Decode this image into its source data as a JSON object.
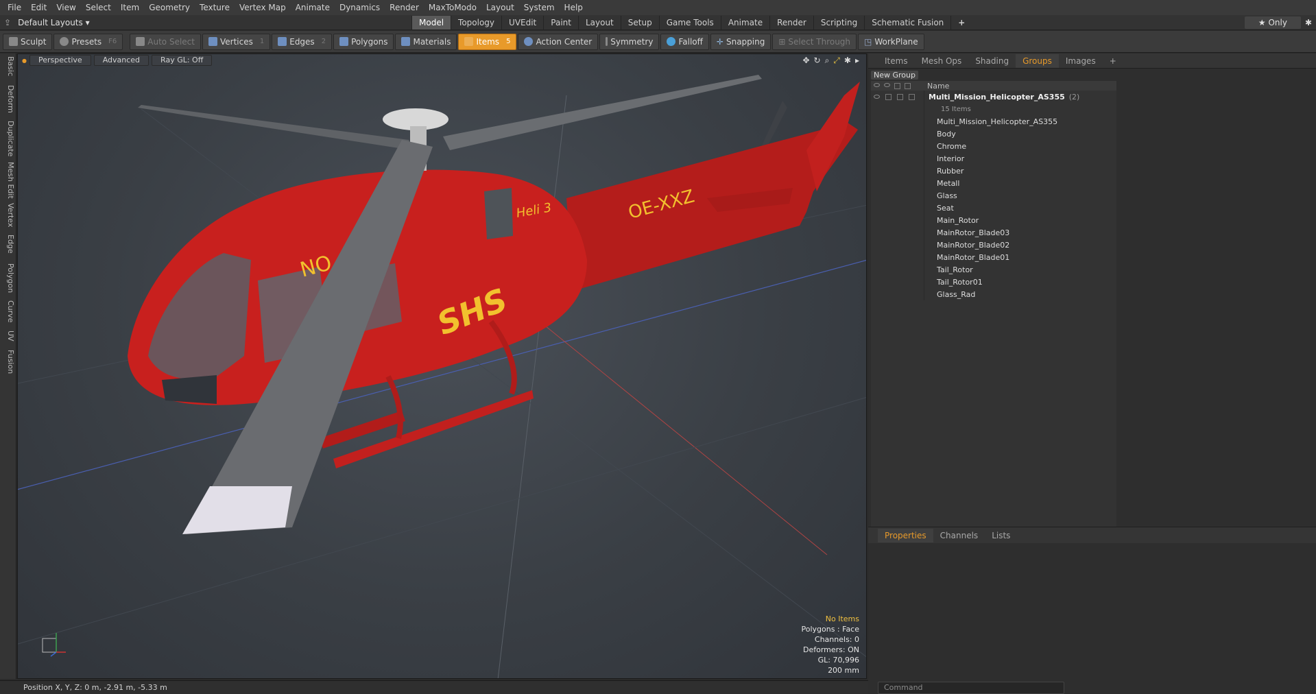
{
  "menu": [
    "File",
    "Edit",
    "View",
    "Select",
    "Item",
    "Geometry",
    "Texture",
    "Vertex Map",
    "Animate",
    "Dynamics",
    "Render",
    "MaxToModo",
    "Layout",
    "System",
    "Help"
  ],
  "layout": {
    "preset": "Default Layouts ▾",
    "tabs": [
      "Model",
      "Topology",
      "UVEdit",
      "Paint",
      "Layout",
      "Setup",
      "Game Tools",
      "Animate",
      "Render",
      "Scripting",
      "Schematic Fusion"
    ],
    "active_tab": "Model",
    "add": "+",
    "only": "★ Only"
  },
  "toolbar": {
    "sculpt": "Sculpt",
    "presets": "Presets",
    "presets_key": "F6",
    "auto_select": "Auto Select",
    "vertices": "Vertices",
    "vertices_key": "1",
    "edges": "Edges",
    "edges_key": "2",
    "polygons": "Polygons",
    "materials": "Materials",
    "items": "Items",
    "items_key": "5",
    "action_center": "Action Center",
    "symmetry": "Symmetry",
    "falloff": "Falloff",
    "snapping": "Snapping",
    "select_through": "Select Through",
    "workplane": "WorkPlane"
  },
  "left_tabs": [
    "Basic",
    "Deform",
    "Duplicate",
    "Mesh Edit",
    "Vertex",
    "Edge",
    "Polygon",
    "Curve",
    "UV",
    "Fusion"
  ],
  "viewport": {
    "view": "Perspective",
    "shading": "Advanced",
    "raygl": "Ray GL: Off",
    "hud": {
      "items": "No Items",
      "polygons": "Polygons : Face",
      "channels": "Channels: 0",
      "deformers": "Deformers: ON",
      "gl": "GL: 70,996",
      "unit": "200 mm"
    },
    "decals": {
      "reg": "OE-XXZ",
      "heli": "Heli 3",
      "shs": "SHS",
      "no": "NO"
    }
  },
  "panel": {
    "tabs": [
      "Items",
      "Mesh Ops",
      "Shading",
      "Groups",
      "Images"
    ],
    "active_tab": "Groups",
    "add": "+",
    "new_group": "New Group",
    "col_name": "Name",
    "group": {
      "name": "Multi_Mission_Helicopter_AS355",
      "count": "(2)",
      "sub": "15 Items"
    },
    "items": [
      "Multi_Mission_Helicopter_AS355",
      "Body",
      "Chrome",
      "Interior",
      "Rubber",
      "Metall",
      "Glass",
      "Seat",
      "Main_Rotor",
      "MainRotor_Blade03",
      "MainRotor_Blade02",
      "MainRotor_Blade01",
      "Tail_Rotor",
      "Tail_Rotor01",
      "Glass_Rad"
    ],
    "lower_tabs": [
      "Properties",
      "Channels",
      "Lists"
    ],
    "lower_active": "Properties",
    "command_placeholder": "Command"
  },
  "status": {
    "position": "Position X, Y, Z:  0 m, -2.91 m, -5.33 m"
  },
  "colors": {
    "accent": "#e89a2a",
    "heli_red": "#c8201e",
    "decal_yellow": "#f2c12e"
  }
}
